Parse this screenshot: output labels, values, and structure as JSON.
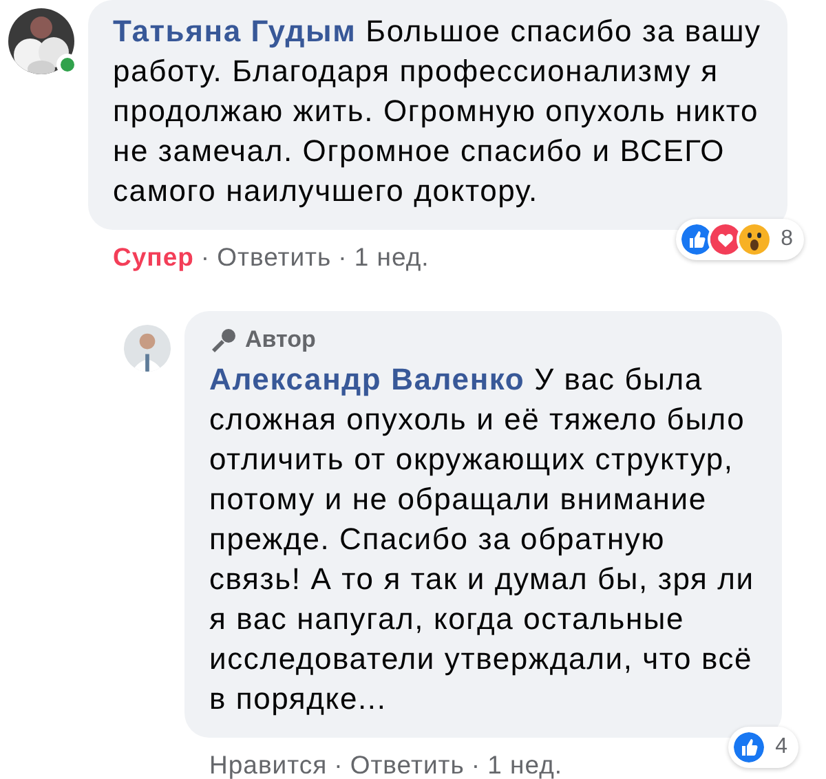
{
  "comments": [
    {
      "author": "Татьяна Гудым",
      "online": true,
      "text": "Большое спасибо за вашу работу. Благодаря профессионализму я продолжаю жить. Огромную опухоль никто не замечал. Огромное спасибо и ВСЕГО самого наилучшего доктору.",
      "reactions": [
        {
          "kind": "like"
        },
        {
          "kind": "love"
        },
        {
          "kind": "wow"
        }
      ],
      "reaction_count": "8",
      "actions": [
        {
          "label": "Супер",
          "kind": "reaction"
        },
        {
          "separator": "·",
          "label": "Ответить",
          "kind": "link"
        },
        {
          "separator": "·",
          "label": "1 нед.",
          "kind": "time"
        }
      ]
    },
    {
      "author": "Александр Валенко",
      "author_badge": "Автор",
      "text": "У вас была сложная опухоль и её тяжело было отличить от окружающих структур, потому и не обращали внимание прежде. Спасибо за обратную связь! А то я так и думал бы, зря ли я вас напугал, когда остальные исследователи утверждали, что всё в порядке...",
      "reactions": [
        {
          "kind": "like"
        }
      ],
      "reaction_count": "4",
      "actions": [
        {
          "label": "Нравится",
          "kind": "link"
        },
        {
          "separator": "·",
          "label": "Ответить",
          "kind": "link"
        },
        {
          "separator": "·",
          "label": "1 нед.",
          "kind": "time"
        }
      ]
    }
  ]
}
